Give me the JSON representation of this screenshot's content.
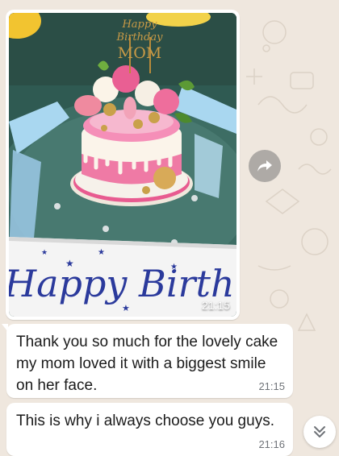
{
  "photo": {
    "topper_line1": "Happy",
    "topper_line2": "Birthday",
    "topper_line3": "MOM",
    "banner_text": "Happy Birth",
    "time": "21:15"
  },
  "messages": [
    {
      "text": "Thank you so much for the lovely cake my mom loved it with a biggest smile on her face.",
      "time": "21:15"
    },
    {
      "text": "This is why i always choose you guys.",
      "time": "21:16"
    }
  ],
  "icons": {
    "forward": "forward-arrow-icon",
    "scroll_down": "double-chevron-down-icon"
  },
  "colors": {
    "wallpaper": "#efe7de",
    "bubble": "#ffffff",
    "timestamp": "#6f7378",
    "cake_pink": "#ef7aa5",
    "banner_text": "#2b3a9c"
  }
}
